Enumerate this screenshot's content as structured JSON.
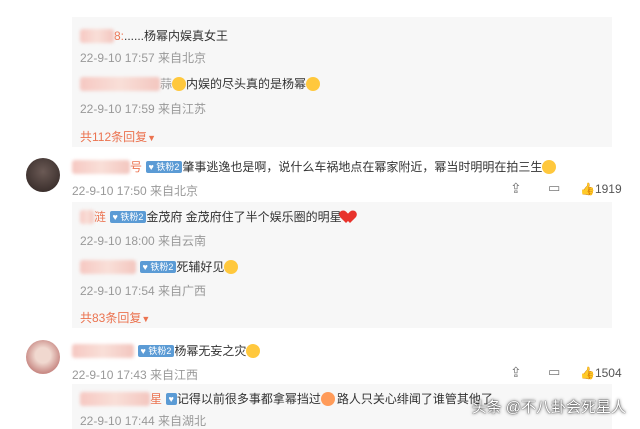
{
  "comments": {
    "c1_reply1": {
      "sep": "8:",
      "text": "......杨幂内娱真女王",
      "meta": "22-9-10 17:57 来自北京"
    },
    "c1_reply2": {
      "sep": "蒜",
      "text": "内娱的尽头真的是杨幂",
      "meta": "22-9-10 17:59 来自江苏"
    },
    "c1_more": "共112条回复",
    "c2": {
      "name_end": "号",
      "badge": "铁粉2",
      "text": "肇事逃逸也是啊，说什么车祸地点在幂家附近，幂当时明明在拍三生",
      "meta": "22-9-10 17:50 来自北京",
      "likes": "1919"
    },
    "c2_reply1": {
      "name_end": "涟",
      "badge": "铁粉2",
      "text": "金茂府 金茂府住了半个娱乐圈的明星",
      "meta": "22-9-10 18:00 来自云南"
    },
    "c2_reply2": {
      "badge": "铁粉2",
      "text": "死辅好见",
      "meta": "22-9-10 17:54 来自广西"
    },
    "c2_more": "共83条回复",
    "c3": {
      "badge": "铁粉2",
      "text": "杨幂无妄之灾",
      "meta": "22-9-10 17:43 来自江西",
      "likes": "1504"
    },
    "c3_reply1": {
      "name_end": "星",
      "text_a": "记得以前很多事都拿幂挡过",
      "text_b": "路人只关心绯闻了谁管其他了",
      "meta": "22-9-10 17:44 来自湖北"
    }
  },
  "watermark": "头条 @不八卦会死星人",
  "icons": {
    "like": "thumbs-up-icon",
    "comment": "comment-icon",
    "share": "share-icon"
  },
  "colors": {
    "link": "#eb7350",
    "meta": "#999999",
    "badge": "#5b9bd5"
  }
}
